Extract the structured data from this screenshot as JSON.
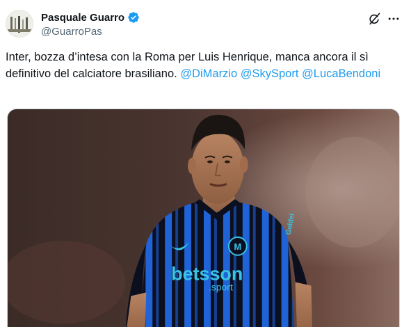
{
  "author": {
    "display_name": "Pasquale Guarro",
    "handle": "@GuarroPas",
    "verified": true
  },
  "tweet": {
    "text_prefix": "Inter, bozza d’intesa con la Roma per Luis Henrique, manca ancora il sì definitivo del calciatore brasiliano. ",
    "mentions": [
      "@DiMarzio",
      "@SkySport",
      "@LucaBendoni"
    ]
  },
  "media": {
    "sponsor_main": "betsson",
    "sponsor_sub": ".sport",
    "sleeve_text": "Goldel"
  },
  "colors": {
    "accent": "#1d9bf0",
    "jersey_blue": "#1f63d6",
    "jersey_dark": "#0b0f1e",
    "sponsor_teal": "#39c3e6"
  },
  "icons": {
    "verified": "verified-badge-icon",
    "grok": "grok-icon",
    "more": "more-icon"
  }
}
